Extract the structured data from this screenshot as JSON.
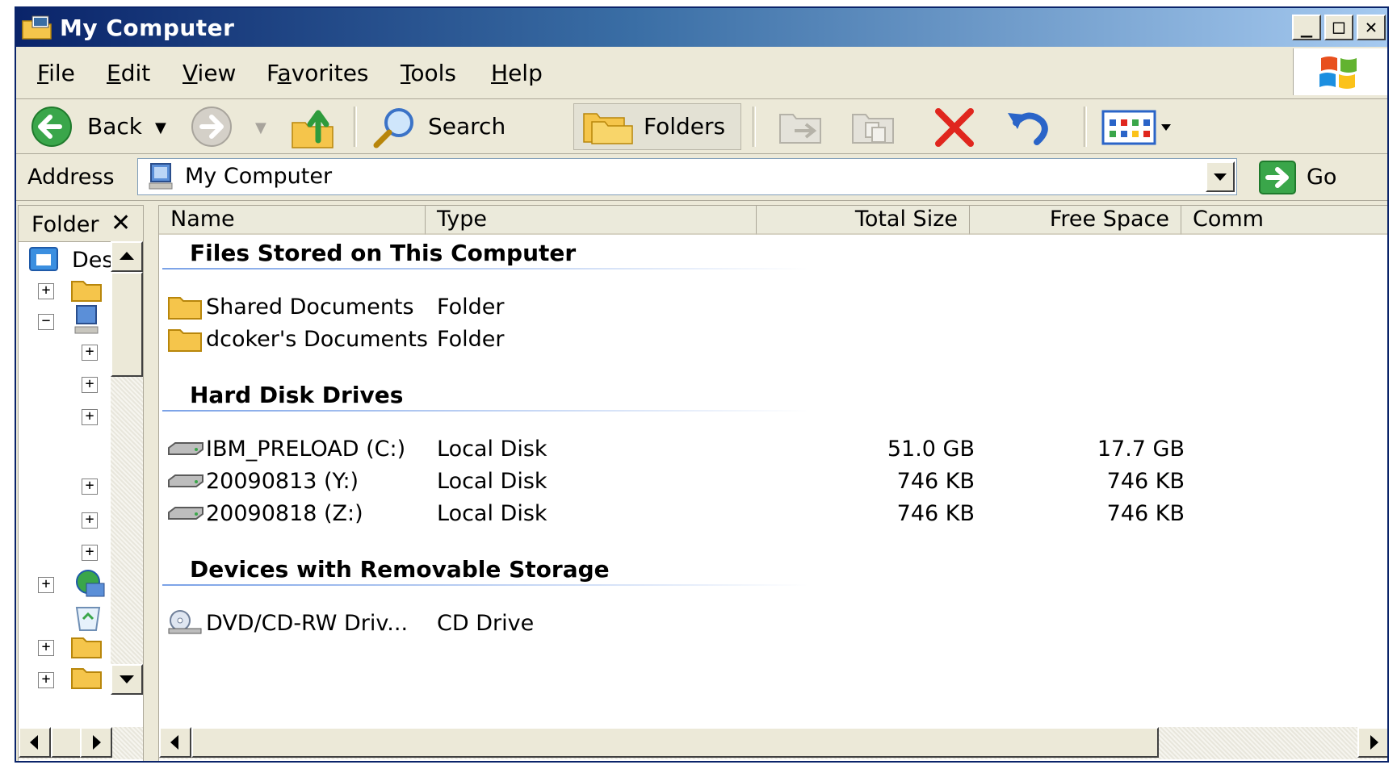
{
  "window": {
    "title": "My Computer"
  },
  "menu": [
    {
      "pre": "",
      "u": "F",
      "post": "ile"
    },
    {
      "pre": "",
      "u": "E",
      "post": "dit"
    },
    {
      "pre": "",
      "u": "V",
      "post": "iew"
    },
    {
      "pre": "F",
      "u": "a",
      "post": "vorites"
    },
    {
      "pre": "",
      "u": "T",
      "post": "ools"
    },
    {
      "pre": "",
      "u": "H",
      "post": "elp"
    }
  ],
  "toolbar": {
    "back_label": "Back",
    "search_label": "Search",
    "folders_label": "Folders"
  },
  "address": {
    "label": "Address",
    "value": "My Computer",
    "go_label": "Go"
  },
  "folder_pane": {
    "title": "Folder",
    "close_glyph": "✕",
    "desktop_label": "Des"
  },
  "columns": [
    "Name",
    "Type",
    "Total Size",
    "Free Space",
    "Comm"
  ],
  "groups": [
    {
      "title": "Files Stored on This Computer"
    },
    {
      "title": "Hard Disk Drives"
    },
    {
      "title": "Devices with Removable Storage"
    }
  ],
  "rows": [
    {
      "name": "Shared Documents",
      "type": "Folder",
      "total": "",
      "free": "",
      "icon": "folder-icon"
    },
    {
      "name": "dcoker's Documents",
      "type": "Folder",
      "total": "",
      "free": "",
      "icon": "folder-icon"
    },
    {
      "name": "IBM_PRELOAD (C:)",
      "type": "Local Disk",
      "total": "51.0 GB",
      "free": "17.7 GB",
      "icon": "hard-disk-icon"
    },
    {
      "name": "20090813 (Y:)",
      "type": "Local Disk",
      "total": "746 KB",
      "free": "746 KB",
      "icon": "hard-disk-icon"
    },
    {
      "name": "20090818 (Z:)",
      "type": "Local Disk",
      "total": "746 KB",
      "free": "746 KB",
      "icon": "hard-disk-icon"
    },
    {
      "name": "DVD/CD-RW Driv...",
      "type": "CD Drive",
      "total": "",
      "free": "",
      "icon": "cd-drive-icon"
    }
  ],
  "colors": {
    "title_start": "#0a246a",
    "title_end": "#a6caf0",
    "chrome": "#ece9d8",
    "group_line": "#7ba2e7"
  }
}
